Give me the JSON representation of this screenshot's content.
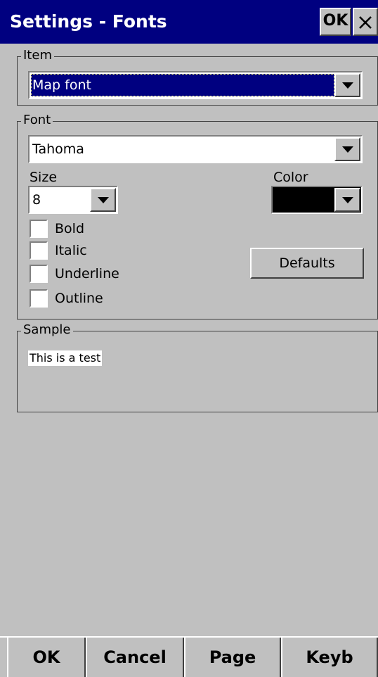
{
  "window": {
    "title": "Settings - Fonts",
    "ok_label": "OK"
  },
  "item_group": {
    "legend": "Item",
    "selected": "Map font"
  },
  "font_group": {
    "legend": "Font",
    "font_name": "Tahoma",
    "size_label": "Size",
    "size_value": "8",
    "color_label": "Color",
    "color_value": "#000000",
    "checkboxes": [
      {
        "label": "Bold",
        "checked": false
      },
      {
        "label": "Italic",
        "checked": false
      },
      {
        "label": "Underline",
        "checked": false
      },
      {
        "label": "Outline",
        "checked": false
      }
    ],
    "defaults_label": "Defaults"
  },
  "sample_group": {
    "legend": "Sample",
    "text": "This is a test"
  },
  "menu": {
    "items": [
      "OK",
      "Cancel",
      "Page",
      "Keyb"
    ]
  }
}
